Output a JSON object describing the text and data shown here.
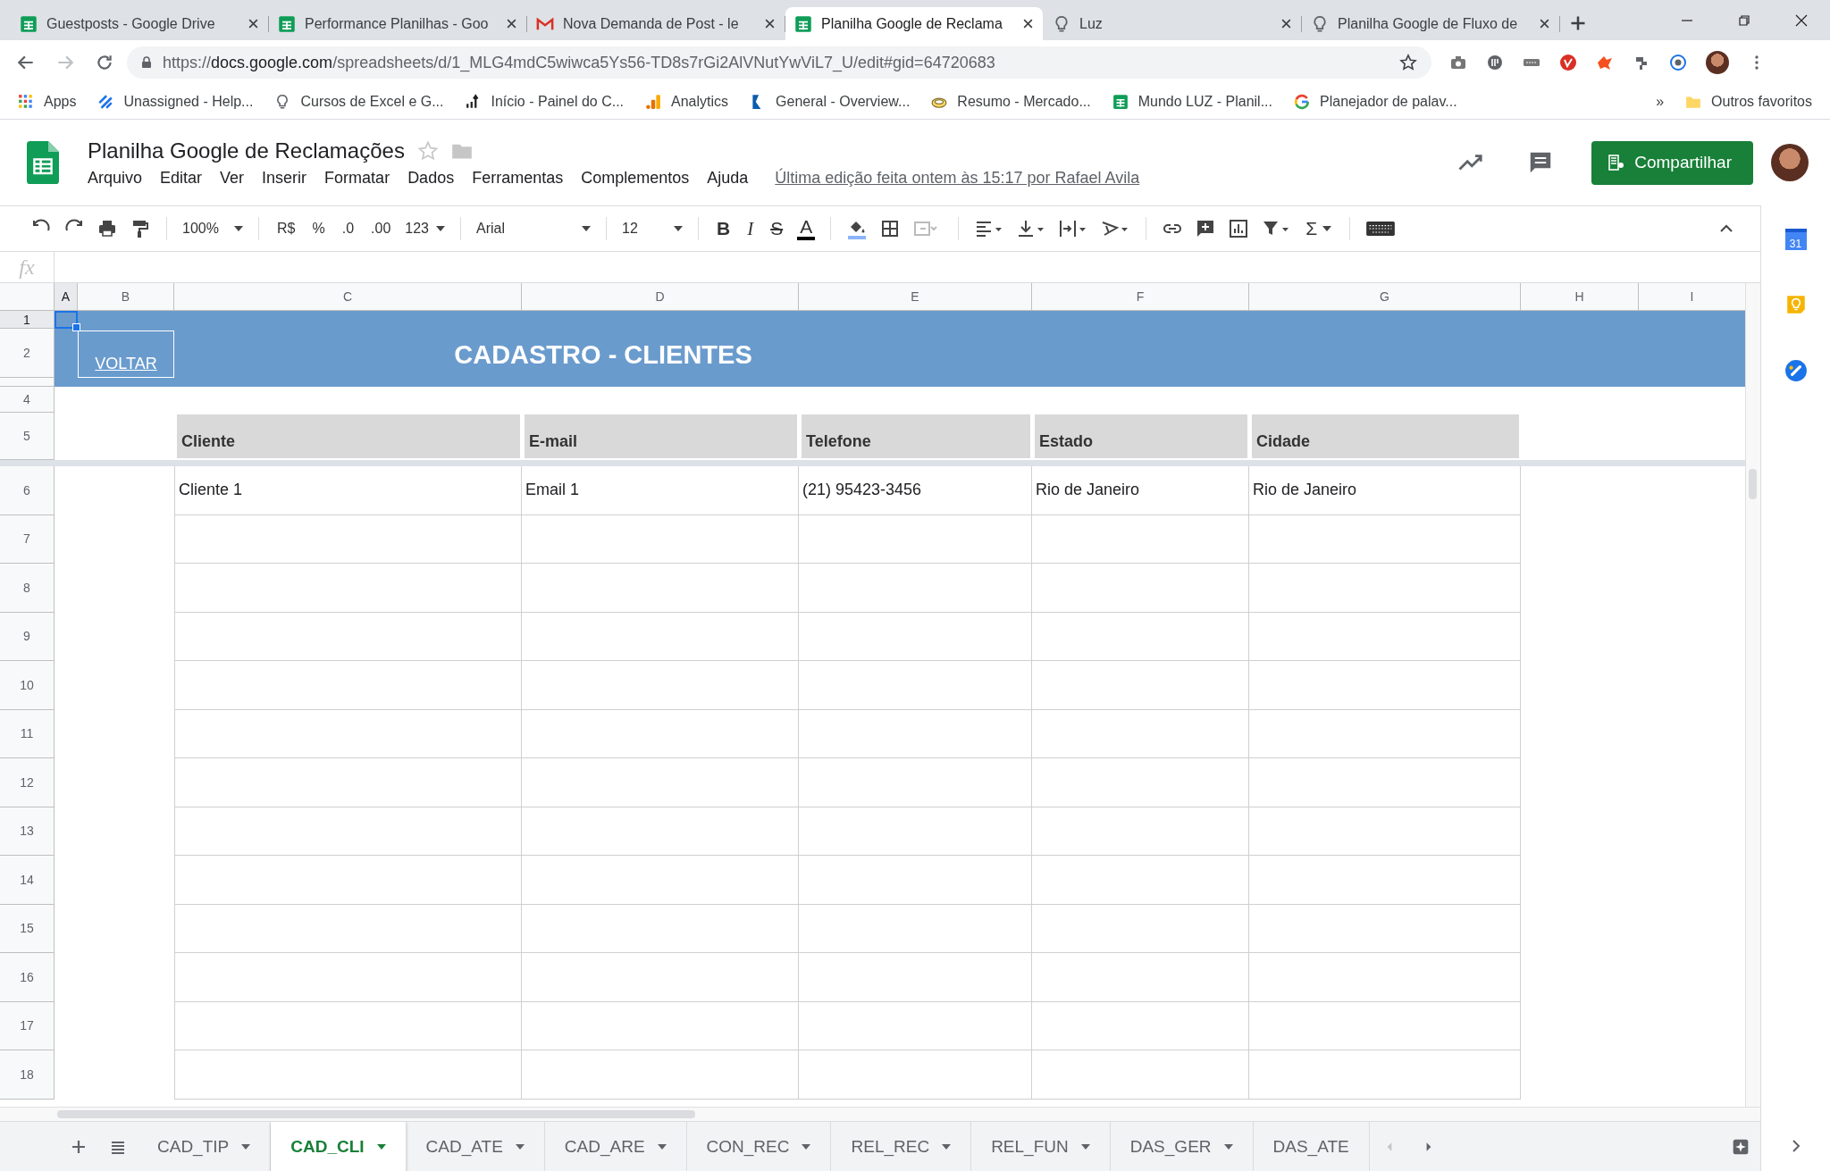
{
  "browser": {
    "tabs": [
      {
        "title": "Guestposts - Google Drive",
        "kind": "sheets",
        "selected": false
      },
      {
        "title": "Performance Planilhas - Goo",
        "kind": "sheets",
        "selected": false
      },
      {
        "title": "Nova Demanda de Post - le",
        "kind": "gmail",
        "selected": false
      },
      {
        "title": "Planilha Google de Reclama",
        "kind": "sheets",
        "selected": true
      },
      {
        "title": "Luz",
        "kind": "bulb",
        "selected": false
      },
      {
        "title": "Planilha Google de Fluxo de",
        "kind": "bulb",
        "selected": false
      }
    ],
    "url_scheme": "https://",
    "url_host": "docs.google.com",
    "url_path": "/spreadsheets/d/1_MLG4mdC5wiwca5Ys56-TD8s7rGi2AlVNutYwViL7_U/edit#gid=64720683",
    "bookmarks": [
      {
        "label": "Apps",
        "kind": "apps"
      },
      {
        "label": "Unassigned - Help...",
        "kind": "stripes"
      },
      {
        "label": "Cursos de Excel e G...",
        "kind": "bulb"
      },
      {
        "label": "Início - Painel do C...",
        "kind": "growth"
      },
      {
        "label": "Analytics",
        "kind": "analytics"
      },
      {
        "label": "General - Overview...",
        "kind": "flag"
      },
      {
        "label": "Resumo - Mercado...",
        "kind": "coin"
      },
      {
        "label": "Mundo LUZ - Planil...",
        "kind": "sheets"
      },
      {
        "label": "Planejador de palav...",
        "kind": "google"
      }
    ],
    "bookmarks_overflow": "»",
    "other_bookmarks": "Outros favoritos"
  },
  "doc": {
    "title": "Planilha Google de Reclamações",
    "menu": [
      "Arquivo",
      "Editar",
      "Ver",
      "Inserir",
      "Formatar",
      "Dados",
      "Ferramentas",
      "Complementos",
      "Ajuda"
    ],
    "last_edit": "Última edição feita ontem às 15:17 por Rafael Avila",
    "share_button": "Compartilhar"
  },
  "toolbar": {
    "zoom": "100%",
    "currency": "R$",
    "percent": "%",
    "decrease_decimals": ".0",
    "increase_decimals": ".00",
    "more_formats": "123",
    "font": "Arial",
    "font_size": "12",
    "bold": "B",
    "italic": "I",
    "strikethrough": "S",
    "text_color": "A",
    "functions": "Σ"
  },
  "formula_bar": {
    "label": "fx"
  },
  "grid": {
    "columns": [
      {
        "label": "A",
        "selected": true
      },
      {
        "label": "B",
        "selected": false
      },
      {
        "label": "C",
        "selected": false
      },
      {
        "label": "D",
        "selected": false
      },
      {
        "label": "E",
        "selected": false
      },
      {
        "label": "F",
        "selected": false
      },
      {
        "label": "G",
        "selected": false
      },
      {
        "label": "H",
        "selected": false
      },
      {
        "label": "I",
        "selected": false
      }
    ],
    "rows": [
      {
        "label": "1",
        "selected": true
      },
      {
        "label": "2",
        "selected": false
      },
      {
        "selected": false
      },
      {
        "label": "4",
        "selected": false
      },
      {
        "label": "5",
        "selected": false
      },
      {
        "label": "6",
        "selected": false
      },
      {
        "label": "7",
        "selected": false
      },
      {
        "label": "8",
        "selected": false
      },
      {
        "label": "9",
        "selected": false
      },
      {
        "label": "10",
        "selected": false
      },
      {
        "label": "11",
        "selected": false
      },
      {
        "label": "12",
        "selected": false
      },
      {
        "label": "13",
        "selected": false
      },
      {
        "label": "14",
        "selected": false
      },
      {
        "label": "15",
        "selected": false
      },
      {
        "label": "16",
        "selected": false
      },
      {
        "label": "17",
        "selected": false
      },
      {
        "label": "18",
        "selected": false
      }
    ]
  },
  "banner": {
    "link": "VOLTAR",
    "title": "CADASTRO - CLIENTES"
  },
  "table": {
    "columns": [
      "Cliente",
      "E-mail",
      "Telefone",
      "Estado",
      "Cidade"
    ],
    "rows": [
      [
        "Cliente 1",
        "Email 1",
        "(21) 95423-3456",
        "Rio de Janeiro",
        "Rio de Janeiro"
      ]
    ]
  },
  "sheet_tabs": [
    {
      "label": "CAD_TIP",
      "selected": false
    },
    {
      "label": "CAD_CLI",
      "selected": true
    },
    {
      "label": "CAD_ATE",
      "selected": false
    },
    {
      "label": "CAD_ARE",
      "selected": false
    },
    {
      "label": "CON_REC",
      "selected": false
    },
    {
      "label": "REL_REC",
      "selected": false
    },
    {
      "label": "REL_FUN",
      "selected": false
    },
    {
      "label": "DAS_GER",
      "selected": false
    },
    {
      "label": "DAS_ATE",
      "selected": false
    }
  ],
  "side_panel": {
    "calendar_day": "31"
  }
}
